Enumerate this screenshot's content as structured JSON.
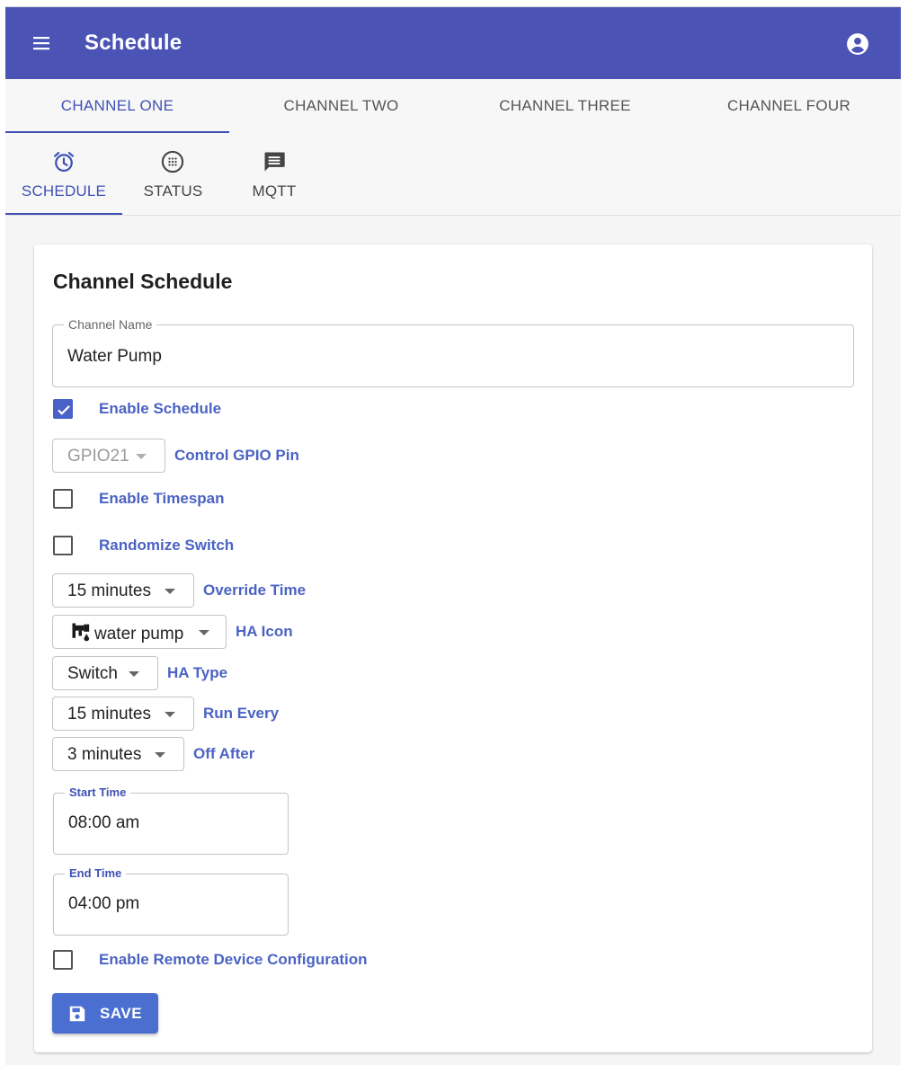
{
  "app": {
    "title": "Schedule"
  },
  "channel_tabs": [
    {
      "label": "CHANNEL ONE",
      "active": true
    },
    {
      "label": "CHANNEL TWO",
      "active": false
    },
    {
      "label": "CHANNEL THREE",
      "active": false
    },
    {
      "label": "CHANNEL FOUR",
      "active": false
    }
  ],
  "section_tabs": [
    {
      "label": "SCHEDULE",
      "icon": "alarm-icon",
      "active": true
    },
    {
      "label": "STATUS",
      "icon": "status-icon",
      "active": false
    },
    {
      "label": "MQTT",
      "icon": "message-icon",
      "active": false
    }
  ],
  "card": {
    "title": "Channel Schedule",
    "channel_name": {
      "label": "Channel Name",
      "value": "Water Pump"
    },
    "enable_schedule": {
      "label": "Enable Schedule",
      "checked": true
    },
    "gpio": {
      "value": "GPIO21",
      "label": "Control GPIO Pin",
      "disabled": true
    },
    "enable_timespan": {
      "label": "Enable Timespan",
      "checked": false
    },
    "randomize_switch": {
      "label": "Randomize Switch",
      "checked": false
    },
    "override_time": {
      "value": "15 minutes",
      "label": "Override Time"
    },
    "ha_icon": {
      "value": "water pump",
      "label": "HA Icon",
      "icon": "water-pump-icon"
    },
    "ha_type": {
      "value": "Switch",
      "label": "HA Type"
    },
    "run_every": {
      "value": "15 minutes",
      "label": "Run Every"
    },
    "off_after": {
      "value": "3 minutes",
      "label": "Off After"
    },
    "start_time": {
      "label": "Start Time",
      "value": "08:00 am"
    },
    "end_time": {
      "label": "End Time",
      "value": "04:00 pm"
    },
    "remote_config": {
      "label": "Enable Remote Device Configuration",
      "checked": false
    },
    "save_label": "SAVE"
  },
  "colors": {
    "app_bar": "#4b54b5",
    "accent": "#3f51b5",
    "label_blue": "#4b63c3",
    "save_button": "#4a6fd0"
  }
}
